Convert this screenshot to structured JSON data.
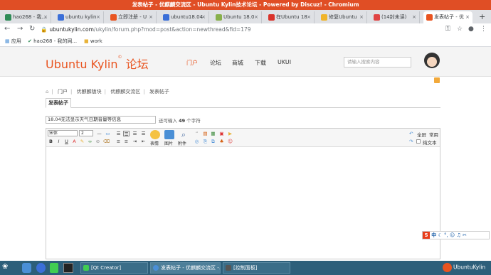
{
  "window": {
    "title": "发表帖子 - 优麒麟交流区 - Ubuntu Kylin技术论坛 - Powered by Discuz! - Chromium"
  },
  "tabs": [
    {
      "label": "hao268 - 我…",
      "color": "#2e8b57",
      "active": false
    },
    {
      "label": "ubuntu kylin",
      "color": "#3b6fd8",
      "active": false
    },
    {
      "label": "立即注册 - U",
      "color": "#e95420",
      "active": false
    },
    {
      "label": "ubuntu18.04",
      "color": "#3b6fd8",
      "active": false
    },
    {
      "label": "Ubuntu 18.0",
      "color": "#88b04b",
      "active": false
    },
    {
      "label": "在Ubuntu 18",
      "color": "#d9332b",
      "active": false
    },
    {
      "label": "修复Ubuntu",
      "color": "#f0b429",
      "active": false
    },
    {
      "label": "(14封未读)",
      "color": "#e04444",
      "active": false
    },
    {
      "label": "发表帖子 - 优",
      "color": "#e95420",
      "active": true
    }
  ],
  "address": {
    "host": "ubuntukylin.com",
    "path": "/ukylin/forum.php?mod=post&action=newthread&fid=179"
  },
  "bookmarks": [
    {
      "label": "应用",
      "icon": "apps-icon"
    },
    {
      "label": "hao268 - 我的网...",
      "icon": "hao-icon"
    },
    {
      "label": "work",
      "icon": "folder-icon"
    }
  ],
  "site": {
    "logo": "Ubuntu Kylin",
    "logo_cn": "论坛",
    "nav": [
      "门户",
      "论坛",
      "商城",
      "下载",
      "UKUI"
    ],
    "active_nav": 0,
    "search_placeholder": "请输入搜索内容"
  },
  "breadcrumb": [
    "门户",
    "优麒麟版块",
    "优麒麟交流区",
    "发表帖子"
  ],
  "page_tab": "发表帖子",
  "subject": {
    "value": "18.04无法显示天气日期音量等信息",
    "hint_prefix": "还可输入 ",
    "hint_count": "49",
    "hint_suffix": " 个字符"
  },
  "editor": {
    "font_select": "宋体",
    "size_select": "2",
    "big_buttons": [
      {
        "label": "表情",
        "icon": "emoticon-icon",
        "color": "#f5c242"
      },
      {
        "label": "图片",
        "icon": "image-icon",
        "color": "#4a8fd6"
      },
      {
        "label": "附件",
        "icon": "attachment-icon",
        "color": "#7a7a7a"
      }
    ],
    "fullscreen_label": "全屏",
    "common_label": "常用",
    "plaintext_label": "纯文本"
  },
  "ime": {
    "logo": "S",
    "mode": "中"
  },
  "taskbar": {
    "items": [
      {
        "label": "[Qt Creator]",
        "color": "#41cd52"
      },
      {
        "label": "发表帖子 - 优麒麟交流区 -…",
        "color": "#4a8fd6"
      },
      {
        "label": "[控制面板]",
        "color": "#555555"
      }
    ],
    "brand": "UbuntuKylin"
  }
}
